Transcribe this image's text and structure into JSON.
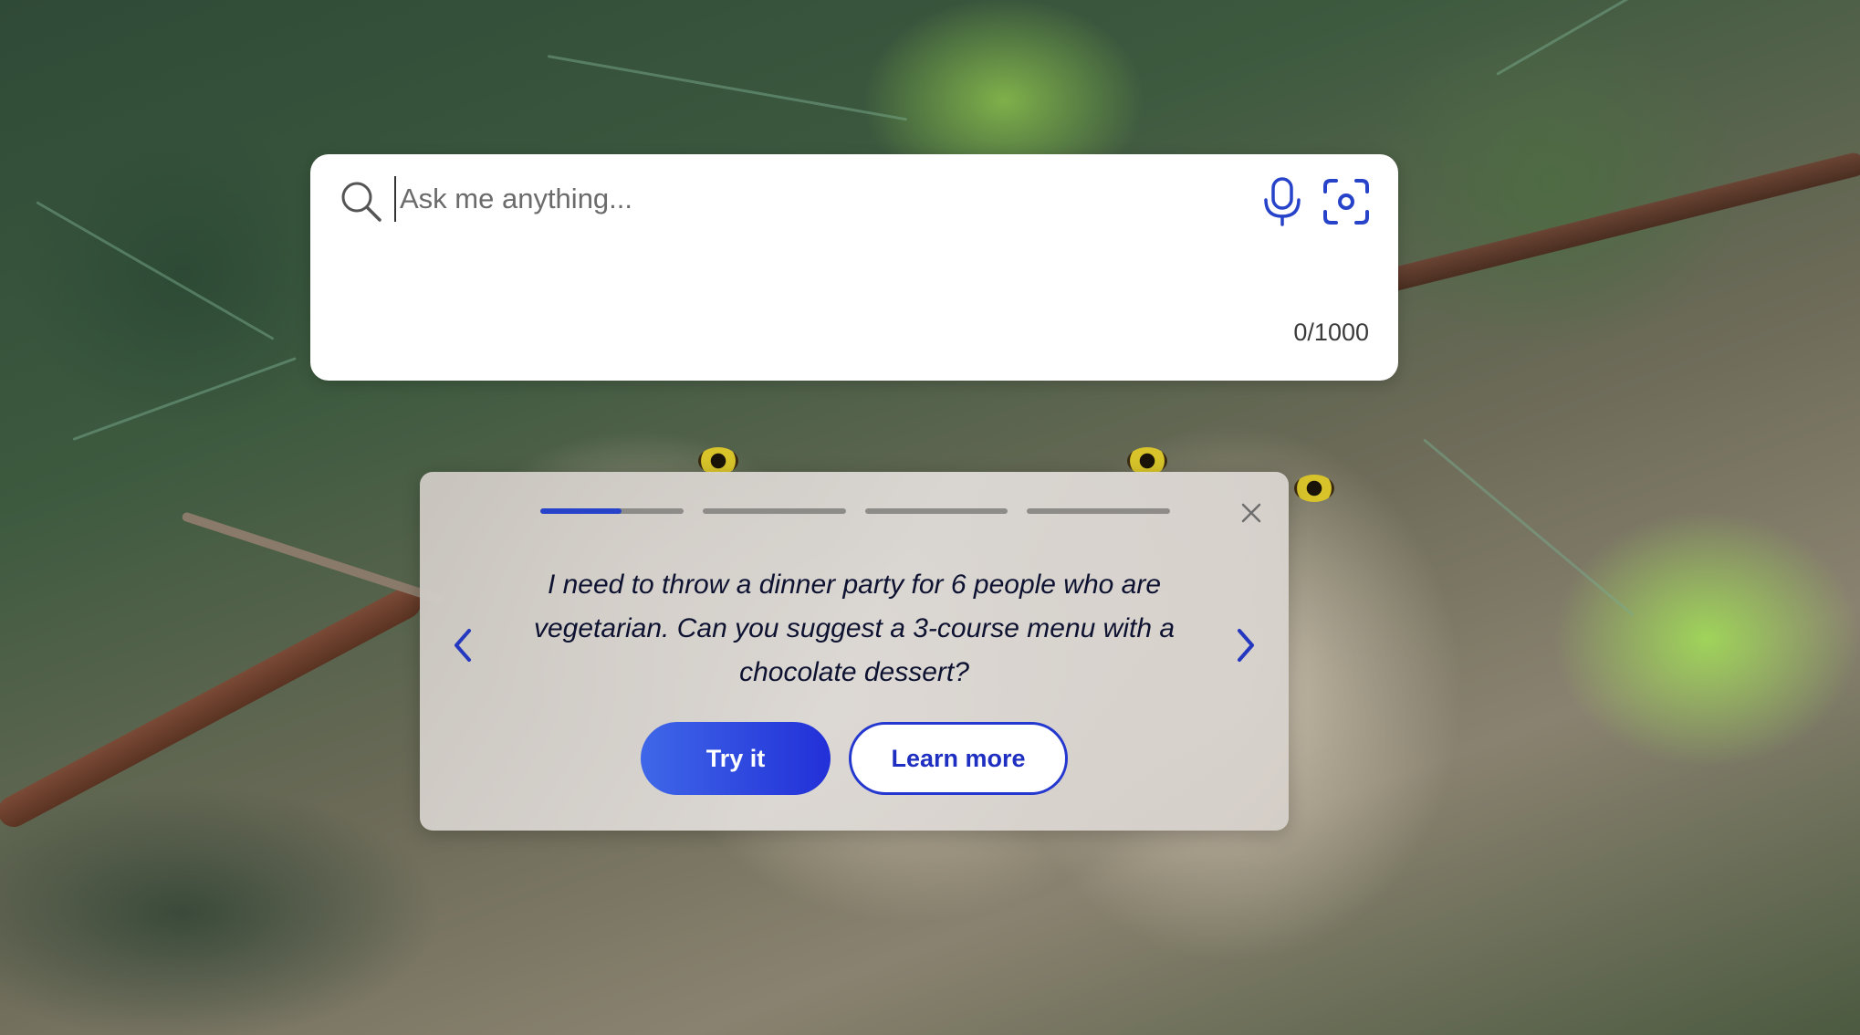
{
  "background": {
    "description_icon": "owl-photo"
  },
  "search": {
    "placeholder": "Ask me anything...",
    "value": "",
    "counter": "0/1000",
    "search_icon": "search-icon",
    "mic_icon": "microphone-icon",
    "visual_search_icon": "camera-scan-icon"
  },
  "suggestion": {
    "progress_total": 4,
    "progress_active_index": 0,
    "progress_active_fraction": 0.57,
    "prompt": "I need to throw a dinner party for 6 people who are vegetarian. Can you suggest a 3-course menu with a chocolate dessert?",
    "try_label": "Try it",
    "learn_label": "Learn more",
    "close_icon": "close-icon",
    "prev_icon": "chevron-left-icon",
    "next_icon": "chevron-right-icon"
  },
  "colors": {
    "accent": "#2743c9",
    "button_gradient_start": "#3f67e8",
    "button_gradient_end": "#2230d8",
    "text_dark": "#0e1231"
  }
}
